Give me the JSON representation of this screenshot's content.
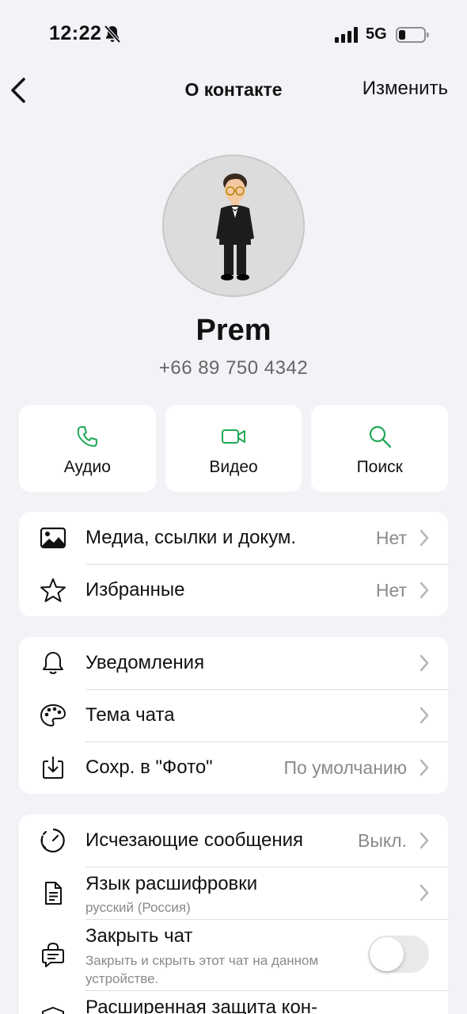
{
  "status_bar": {
    "time": "12:22",
    "network": "5G"
  },
  "nav": {
    "title": "О контакте",
    "edit_label": "Изменить"
  },
  "contact": {
    "name": "Prem",
    "phone": "+66 89 750 4342"
  },
  "actions": [
    {
      "label": "Аудио",
      "icon": "phone-icon"
    },
    {
      "label": "Видео",
      "icon": "video-icon"
    },
    {
      "label": "Поиск",
      "icon": "search-icon"
    }
  ],
  "group1": {
    "media": {
      "label": "Медиа, ссылки и докум.",
      "value": "Нет"
    },
    "starred": {
      "label": "Избранные",
      "value": "Нет"
    }
  },
  "group2": {
    "notifications": {
      "label": "Уведомления"
    },
    "theme": {
      "label": "Тема чата"
    },
    "save_photos": {
      "label": "Сохр. в \"Фото\"",
      "value": "По умолчанию"
    }
  },
  "group3": {
    "disappearing": {
      "label": "Исчезающие сообщения",
      "value": "Выкл."
    },
    "transcription": {
      "label": "Язык расшифровки",
      "sub": "русский (Россия)"
    },
    "lock_chat": {
      "label": "Закрыть чат",
      "sub_line1": "Закрыть и скрыть этот чат на данном",
      "sub_line2": "устройстве.",
      "enabled": false
    },
    "advanced": {
      "label": "Расширенная защита кон-"
    }
  },
  "colors": {
    "accent": "#1fa855",
    "background": "#f2f2f7",
    "card": "#ffffff",
    "secondary_text": "#8a8a8e"
  }
}
